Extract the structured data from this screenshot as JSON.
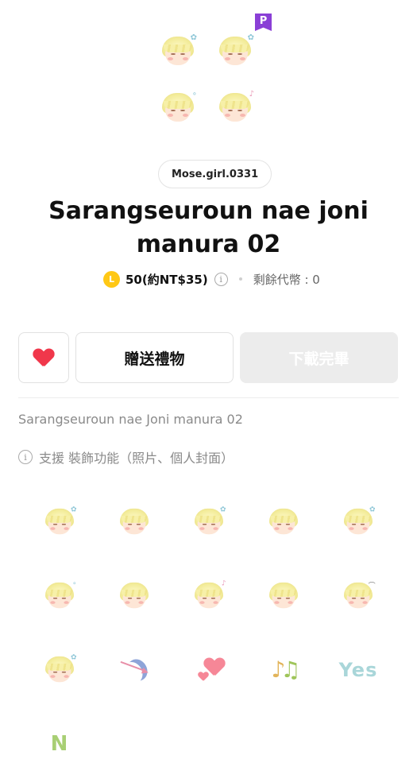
{
  "header": {
    "premium_badge": "P",
    "author": "Mose.girl.0331",
    "title": "Sarangseuroun nae joni manura 02"
  },
  "price": {
    "coin_letter": "L",
    "amount": "50(約NT$35)",
    "info_glyph": "i",
    "balance": "剩餘代幣 : 0"
  },
  "actions": {
    "gift_label": "贈送禮物",
    "download_label": "下載完畢"
  },
  "description": "Sarangseuroun nae Joni manura 02",
  "support": {
    "info_glyph": "i",
    "text": "支援 裝飾功能（照片、個人封面）"
  },
  "stickers": {
    "yes_text": "Yes",
    "no_text": "N"
  },
  "colors": {
    "accent": "#f0374b",
    "premium": "#8a3fd6",
    "coin": "#ffc815",
    "disabled_button": "#ececec",
    "muted_text": "#8a8a8a"
  }
}
